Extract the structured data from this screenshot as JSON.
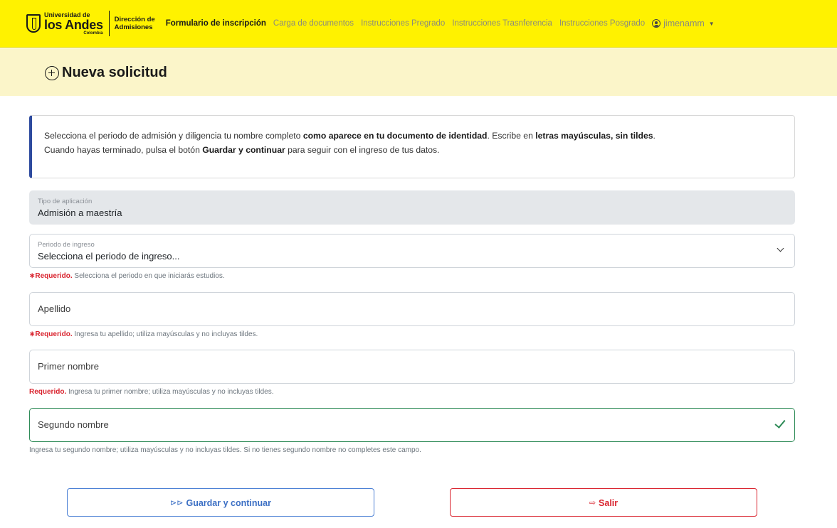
{
  "navbar": {
    "logo": {
      "uni": "Universidad de",
      "andes": "los Andes",
      "country": "Colombia",
      "dept_line1": "Dirección de",
      "dept_line2": "Admisiones"
    },
    "links": [
      {
        "label": "Formulario de inscripción",
        "active": true
      },
      {
        "label": "Carga de documentos",
        "active": false
      },
      {
        "label": "Instrucciones Pregrado",
        "active": false
      },
      {
        "label": "Instrucciones Trasnferencia",
        "active": false
      },
      {
        "label": "Instrucciones Posgrado",
        "active": false
      }
    ],
    "user": {
      "name": "jimenamm",
      "icon": "user-circle-icon",
      "caret_icon": "caret-down-icon"
    },
    "bg_color": "#fff200"
  },
  "header": {
    "title": "Nueva solicitud",
    "icon": "plus-circle-icon",
    "bg_color": "#fbf5c9"
  },
  "info": {
    "line1_a": "Selecciona el periodo de admisión y diligencia tu nombre completo ",
    "line1_b": "como aparece en tu documento de identidad",
    "line1_c": ". Escribe en ",
    "line1_d": "letras mayúsculas, sin tildes",
    "line1_e": ".",
    "line2_a": "Cuando hayas terminado, pulsa el botón ",
    "line2_b": "Guardar y continuar",
    "line2_c": " para seguir con el ingreso de tus datos."
  },
  "form": {
    "tipo": {
      "label": "Tipo de aplicación",
      "value": "Admisión a maestría"
    },
    "periodo": {
      "label": "Periodo de ingreso",
      "value": "Selecciona el periodo de ingreso...",
      "icon": "chevron-down-icon",
      "req_mark": "∗",
      "req_label": "Requerido.",
      "help": " Selecciona el periodo en que iniciarás estudios."
    },
    "apellido": {
      "placeholder": "Apellido",
      "req_mark": "∗",
      "req_label": "Requerido.",
      "help": " Ingresa tu apellido; utiliza mayúsculas y no incluyas tildes."
    },
    "primer": {
      "placeholder": "Primer nombre",
      "req_label": "Requerido.",
      "help": " Ingresa tu primer nombre; utiliza mayúsculas y no incluyas tildes."
    },
    "segundo": {
      "placeholder": "Segundo nombre",
      "icon": "check-icon",
      "help": "Ingresa tu segundo nombre; utiliza mayúsculas y no incluyas tildes. Si no tienes segundo nombre no completes este campo."
    }
  },
  "buttons": {
    "save": {
      "icon_glyph": "⊳⊳",
      "label": "Guardar y continuar",
      "color": "#3b6fc4"
    },
    "exit": {
      "icon_glyph": "⇨",
      "label": "Salir",
      "color": "#d9232e"
    }
  }
}
